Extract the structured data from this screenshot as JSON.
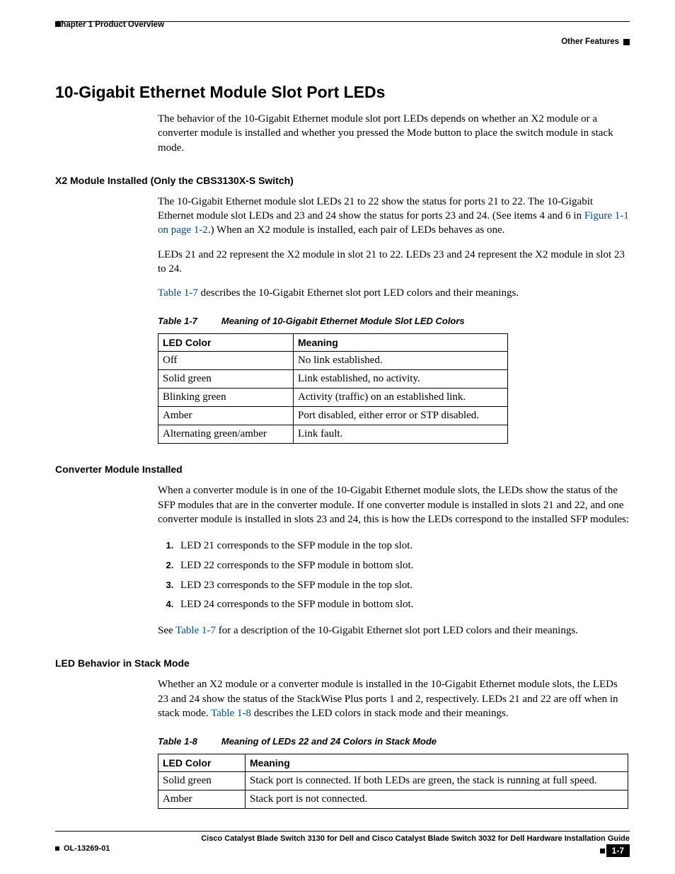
{
  "header": {
    "chapter": "Chapter 1      Product Overview",
    "section": "Other Features"
  },
  "h_main": "10-Gigabit Ethernet Module Slot Port LEDs",
  "intro": "The behavior of the 10-Gigabit Ethernet module slot port LEDs depends on whether an X2 module or a converter module is installed and whether you pressed the Mode button to place the switch module in stack mode.",
  "x2": {
    "heading": "X2 Module Installed (Only the CBS3130X-S Switch)",
    "p1a": "The 10-Gigabit Ethernet module slot LEDs 21 to 22 show the status for ports 21 to 22. The 10-Gigabit Ethernet module slot LEDs and 23 and 24 show the status for ports 23 and 24. (See items 4 and 6 in ",
    "p1_link": "Figure 1-1 on page 1-2",
    "p1b": ".) When an X2 module is installed, each pair of LEDs behaves as one.",
    "p2": "LEDs 21 and 22 represent the X2 module in slot 21 to 22. LEDs 23 and 24 represent the X2 module in slot 23 to 24.",
    "p3_link": "Table 1-7",
    "p3_rest": " describes the 10-Gigabit Ethernet slot port LED colors and their meanings."
  },
  "table7": {
    "caption_num": "Table 1-7",
    "caption_title": "Meaning of 10-Gigabit Ethernet Module Slot LED Colors",
    "headers": [
      "LED Color",
      "Meaning"
    ],
    "rows": [
      [
        "Off",
        "No link established."
      ],
      [
        "Solid green",
        "Link established, no activity."
      ],
      [
        "Blinking green",
        "Activity (traffic) on an established link."
      ],
      [
        "Amber",
        "Port disabled, either error or STP disabled."
      ],
      [
        "Alternating green/amber",
        "Link fault."
      ]
    ]
  },
  "conv": {
    "heading": "Converter Module Installed",
    "p1": "When a converter module is in one of the 10-Gigabit Ethernet module slots, the LEDs show the status of the SFP modules that are in the converter module. If one converter module is installed in slots 21 and 22, and one converter module is installed in slots 23 and 24, this is how the LEDs correspond to the installed SFP modules:",
    "items": [
      "LED 21 corresponds to the SFP module in the top slot.",
      "LED 22 corresponds to the SFP module in bottom slot.",
      "LED 23 corresponds to the SFP module in the top slot.",
      "LED 24 corresponds to the SFP module in bottom slot."
    ],
    "p2_pre": "See ",
    "p2_link": "Table 1-7",
    "p2_post": " for a description of the 10-Gigabit Ethernet slot port LED colors and their meanings."
  },
  "stack": {
    "heading": "LED Behavior in Stack Mode",
    "p1_pre": "Whether an X2 module or a converter module is installed in the 10-Gigabit Ethernet module slots, the LEDs 23 and 24 show the status of the StackWise Plus ports 1 and 2, respectively. LEDs 21 and 22 are off when in stack mode. ",
    "p1_link": "Table 1-8",
    "p1_post": " describes the LED colors in stack mode and their meanings."
  },
  "table8": {
    "caption_num": "Table 1-8",
    "caption_title": "Meaning of LEDs 22 and 24 Colors in Stack Mode",
    "headers": [
      "LED Color",
      "Meaning"
    ],
    "rows": [
      [
        "Solid green",
        "Stack port is connected. If both LEDs are green, the stack is running at full speed."
      ],
      [
        "Amber",
        "Stack port is not connected."
      ]
    ]
  },
  "footer": {
    "guide": "Cisco Catalyst Blade Switch 3130 for Dell and Cisco Catalyst Blade Switch 3032 for Dell Hardware Installation Guide",
    "doc": "OL-13269-01",
    "page": "1-7"
  }
}
